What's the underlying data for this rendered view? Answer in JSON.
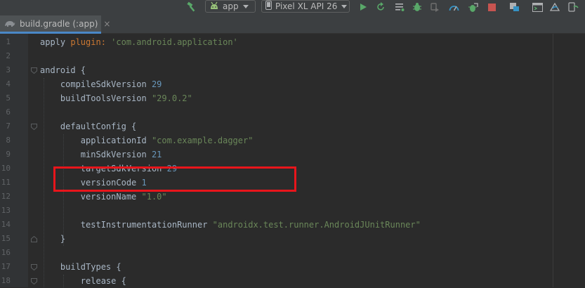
{
  "toolbar": {
    "run_config": "app",
    "device": "Pixel XL API 26"
  },
  "tab": {
    "label": "build.gradle (:app)",
    "close": "×"
  },
  "lines": [
    {
      "num": "1",
      "parts": [
        {
          "t": "apply",
          "c": "plain"
        },
        {
          "t": " plugin: ",
          "c": "kw"
        },
        {
          "t": "'com.android.application'",
          "c": "str"
        }
      ]
    },
    {
      "num": "2",
      "parts": []
    },
    {
      "num": "3",
      "parts": [
        {
          "t": "android {",
          "c": "plain"
        }
      ]
    },
    {
      "num": "4",
      "parts": [
        {
          "t": "    compileSdkVersion ",
          "c": "plain"
        },
        {
          "t": "29",
          "c": "num"
        }
      ]
    },
    {
      "num": "5",
      "parts": [
        {
          "t": "    buildToolsVersion ",
          "c": "plain"
        },
        {
          "t": "\"29.0.2\"",
          "c": "str"
        }
      ]
    },
    {
      "num": "6",
      "parts": []
    },
    {
      "num": "7",
      "parts": [
        {
          "t": "    defaultConfig {",
          "c": "plain"
        }
      ]
    },
    {
      "num": "8",
      "parts": [
        {
          "t": "        applicationId ",
          "c": "plain"
        },
        {
          "t": "\"com.example.dagger\"",
          "c": "str"
        }
      ]
    },
    {
      "num": "9",
      "parts": [
        {
          "t": "        minSdkVersion ",
          "c": "plain"
        },
        {
          "t": "21",
          "c": "num"
        }
      ]
    },
    {
      "num": "10",
      "parts": [
        {
          "t": "        targetSdkVersion ",
          "c": "plain"
        },
        {
          "t": "29",
          "c": "num"
        }
      ]
    },
    {
      "num": "11",
      "parts": [
        {
          "t": "        versionCode ",
          "c": "plain"
        },
        {
          "t": "1",
          "c": "num"
        }
      ]
    },
    {
      "num": "12",
      "parts": [
        {
          "t": "        versionName ",
          "c": "plain"
        },
        {
          "t": "\"1.0\"",
          "c": "str"
        }
      ]
    },
    {
      "num": "13",
      "parts": []
    },
    {
      "num": "14",
      "parts": [
        {
          "t": "        testInstrumentationRunner ",
          "c": "plain"
        },
        {
          "t": "\"androidx.test.runner.AndroidJUnitRunner\"",
          "c": "str"
        }
      ]
    },
    {
      "num": "15",
      "parts": [
        {
          "t": "    }",
          "c": "plain"
        }
      ]
    },
    {
      "num": "16",
      "parts": []
    },
    {
      "num": "17",
      "parts": [
        {
          "t": "    buildTypes {",
          "c": "plain"
        }
      ]
    },
    {
      "num": "18",
      "parts": [
        {
          "t": "        release {",
          "c": "plain"
        }
      ]
    }
  ],
  "fold_markers": {
    "3": "fold-open",
    "7": "fold-open",
    "15": "fold-close",
    "17": "fold-open",
    "18": "fold-open"
  },
  "colors": {
    "string": "#6a8759",
    "number": "#6897bb",
    "keyword": "#cc7832",
    "annotation_box": "#e8151b"
  },
  "icons": {
    "toolbar": [
      "hammer-icon",
      "android-icon",
      "device-icon",
      "run-icon",
      "rerun-icon",
      "coverage-icon",
      "debug-icon",
      "attach-debugger-icon",
      "profile-icon",
      "apply-changes-icon",
      "stop-icon",
      "sync-icon",
      "sdk-manager-icon",
      "terminal-icon",
      "avd-manager-icon",
      "search-everywhere-icon"
    ]
  }
}
